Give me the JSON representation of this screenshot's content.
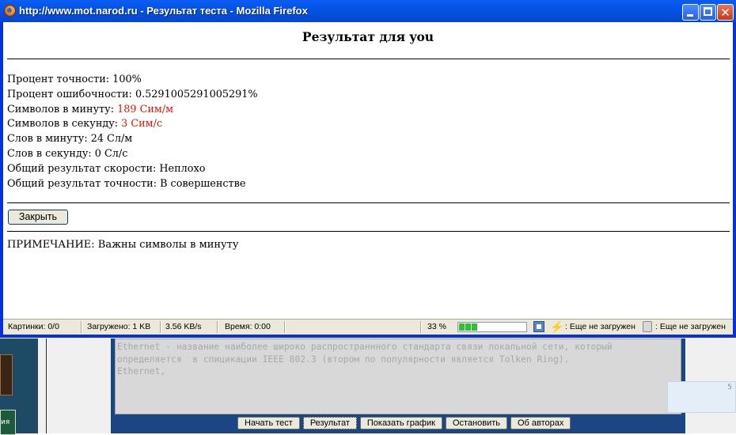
{
  "window": {
    "title": "http://www.mot.narod.ru - Результат теста - Mozilla Firefox"
  },
  "result": {
    "heading": "Результат для you",
    "stats": [
      {
        "label": "Процент точности: ",
        "value": "100%",
        "highlight": false
      },
      {
        "label": "Процент ошибочности: ",
        "value": "0.5291005291005291%",
        "highlight": false
      },
      {
        "label": "Символов в минуту: ",
        "value": "189 Сим/м",
        "highlight": true
      },
      {
        "label": "Символов в секунду: ",
        "value": "3 Сим/с",
        "highlight": true
      },
      {
        "label": "Слов в минуту: ",
        "value": "24 Сл/м",
        "highlight": false
      },
      {
        "label": "Слов в секунду: ",
        "value": "0 Сл/с",
        "highlight": false
      },
      {
        "label": "Общий результат скорости: ",
        "value": "Неплохо",
        "highlight": false
      },
      {
        "label": "Общий результат точности: ",
        "value": "В совершенстве",
        "highlight": false
      }
    ],
    "close_button": "Закрыть",
    "note": "ПРИМЕЧАНИЕ: Важны символы в минуту"
  },
  "statusbar": {
    "images": "Картинки: 0/0",
    "loaded": "Загружено: 1 KB",
    "speed": "3.56 KB/s",
    "time": "Время: 0:00",
    "percent": "33 %",
    "progress_fraction": 0.33,
    "status1": ": Еще не загружен",
    "status2": ": Еще не загружен"
  },
  "background_page": {
    "textarea_text": "Ethernet - название наиболее широко распространнного стандарта связи локальной сети, который\nопределяется  в спицикации IEEE 802.3 (втором по популярности является Tolken Ring).\nEthernet,",
    "buttons": {
      "start": "Начать тест",
      "result": "Результат",
      "graph": "Показать график",
      "stop": "Остановить",
      "authors": "Об авторах"
    },
    "left_thumb_text": "ия",
    "right_box_number": "5"
  },
  "colors": {
    "titlebar": "#0553e3",
    "highlight_text": "#ee1100",
    "background_frame": "#1c4583"
  }
}
